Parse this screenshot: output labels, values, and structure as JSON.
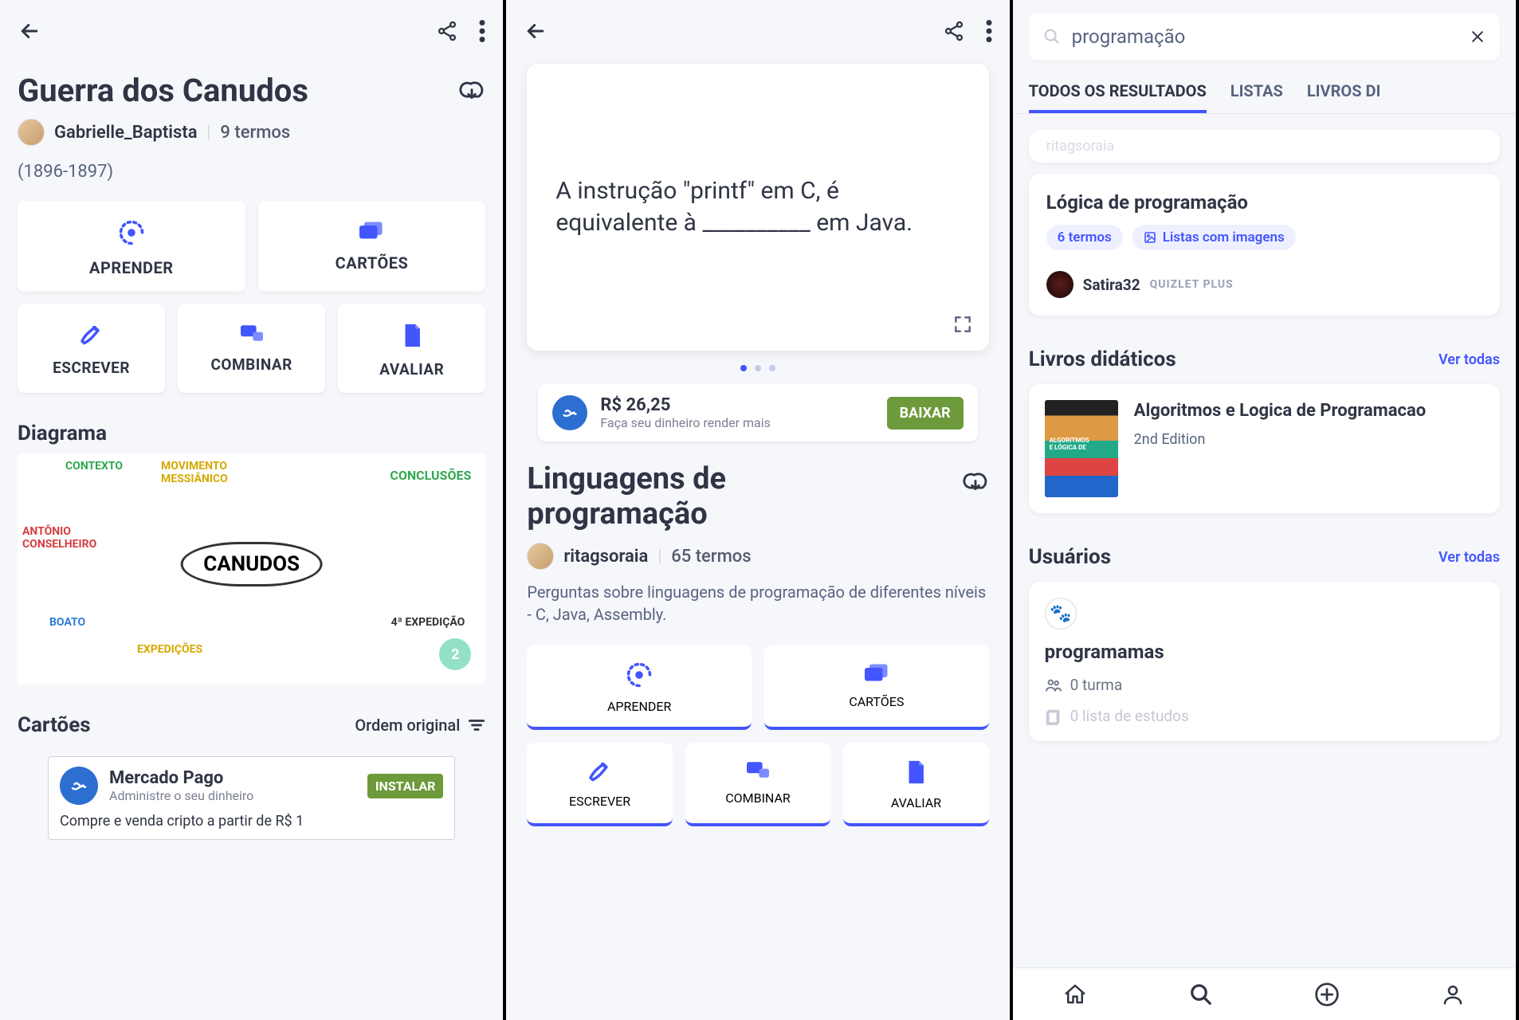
{
  "screen1": {
    "title": "Guerra dos Canudos",
    "author": "Gabrielle_Baptista",
    "terms": "9 termos",
    "years": "(1896-1897)",
    "tiles2": [
      "APRENDER",
      "CARTÕES"
    ],
    "tiles3": [
      "ESCREVER",
      "COMBINAR",
      "AVALIAR"
    ],
    "diagram_heading": "Diagrama",
    "diagram_badge": "2",
    "diagram_labels": {
      "center": "CANUDOS",
      "t1": "CONTEXTO",
      "t2": "MOVIMENTO\nMESSIÂNICO",
      "t3": "CONCLUSÕES",
      "t4": "ANTÔNIO\nCONSELHEIRO",
      "t5": "BOATO",
      "t6": "EXPEDIÇÕES",
      "t7": "4ª EXPEDIÇÃO"
    },
    "cards_heading": "Cartões",
    "order_label": "Ordem original",
    "ad": {
      "title": "Mercado Pago",
      "subtitle": "Administre o seu dinheiro",
      "cta": "INSTALAR",
      "line2": "Compre e venda cripto a partir de R$ 1"
    }
  },
  "screen2": {
    "flashcard_text": "A instrução \"printf\" em C, é equivalente à __________ em Java.",
    "ad": {
      "price": "R$ 26,25",
      "subtitle": "Faça seu dinheiro render mais",
      "cta": "BAIXAR"
    },
    "title": "Linguagens de programação",
    "author": "ritagsoraia",
    "terms": "65 termos",
    "description": "Perguntas sobre linguagens de programação de diferentes níveis - C, Java, Assembly.",
    "tiles2": [
      "APRENDER",
      "CARTÕES"
    ],
    "tiles3": [
      "ESCREVER",
      "COMBINAR",
      "AVALIAR"
    ]
  },
  "screen3": {
    "search_value": "programação",
    "tabs": [
      "TODOS OS RESULTADOS",
      "LISTAS",
      "LIVROS DI"
    ],
    "set_card": {
      "title": "Lógica de programação",
      "chip1": "6 termos",
      "chip2": "Listas com imagens",
      "user": "Satira32",
      "badge": "QUIZLET PLUS"
    },
    "textbooks": {
      "heading": "Livros didáticos",
      "link": "Ver todas",
      "book_title": "Algoritmos e Logica de Programacao",
      "edition": "2nd Edition"
    },
    "users": {
      "heading": "Usuários",
      "link": "Ver todas",
      "username": "programamas",
      "meta1": "0 turma",
      "meta2": "0 lista de estudos"
    }
  }
}
